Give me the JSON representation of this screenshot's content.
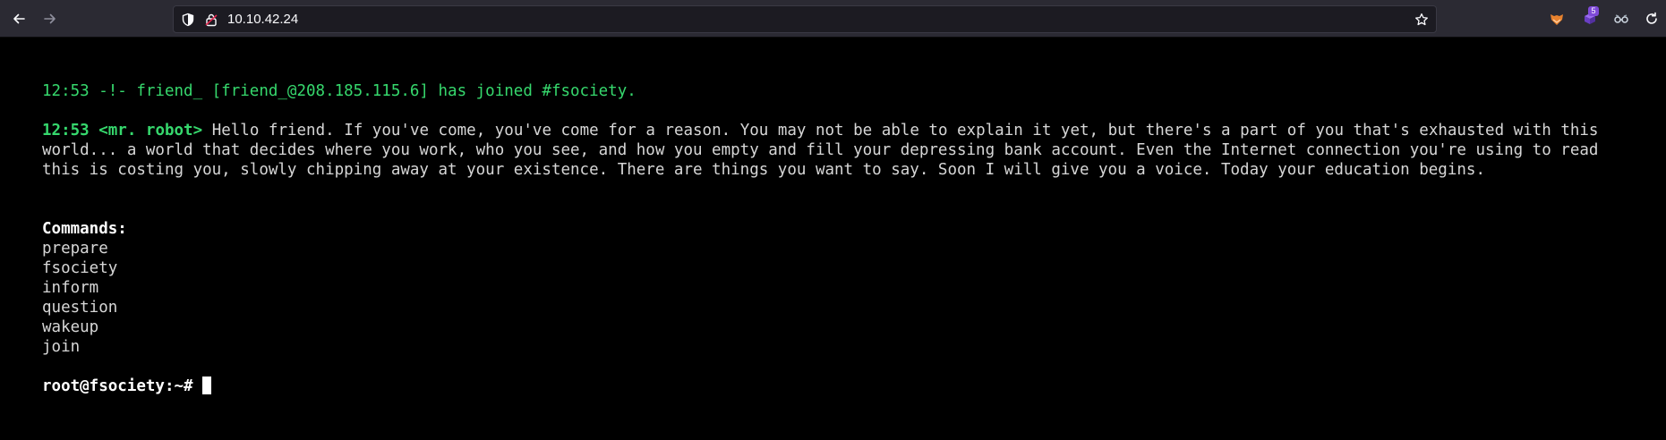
{
  "browser": {
    "url": "10.10.42.24",
    "extension_badge": "5"
  },
  "terminal": {
    "join_line": "12:53 -!- friend_ [friend_@208.185.115.6] has joined #fsociety.",
    "message": {
      "timestamp": "12:53",
      "nick": "<mr. robot>",
      "text": "Hello friend. If you've come, you've come for a reason. You may not be able to explain it yet, but there's a part of you that's exhausted with this world... a world that decides where you work, who you see, and how you empty and fill your depressing bank account. Even the Internet connection you're using to read this is costing you, slowly chipping away at your existence. There are things you want to say. Soon I will give you a voice. Today your education begins."
    },
    "commands_title": "Commands:",
    "commands": [
      "prepare",
      "fsociety",
      "inform",
      "question",
      "wakeup",
      "join"
    ],
    "prompt": "root@fsociety:~#"
  },
  "colors": {
    "background": "#000000",
    "irc_green": "#36d86d",
    "text": "#d6d6d6",
    "toolbar": "#2b2a33"
  },
  "icons": [
    "back-arrow-icon",
    "forward-arrow-icon",
    "shield-icon",
    "lock-icon",
    "star-icon",
    "fox-extension-icon",
    "purple-extension-icon",
    "glasses-extension-icon",
    "reload-icon"
  ]
}
